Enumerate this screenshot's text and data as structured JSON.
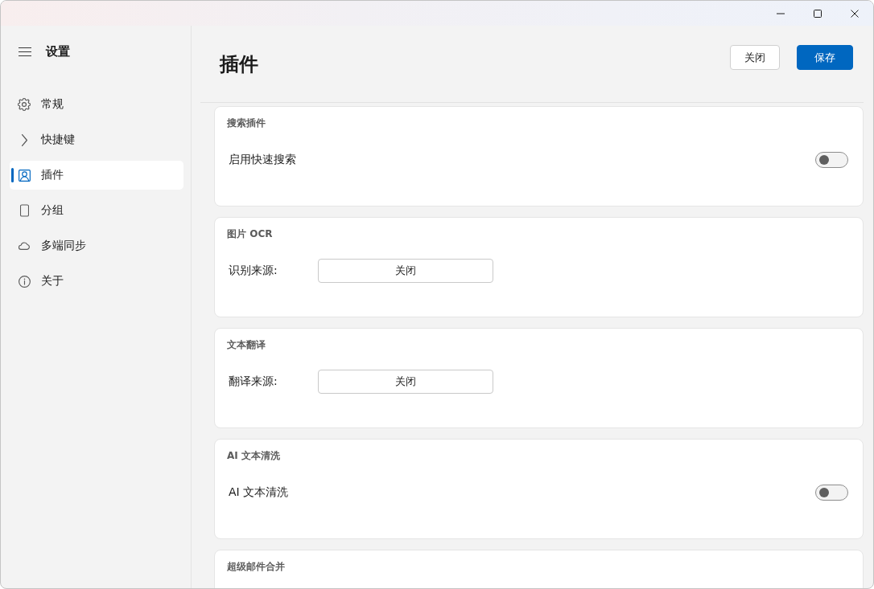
{
  "sidebar": {
    "title": "设置",
    "items": [
      {
        "label": "常规",
        "selected": false
      },
      {
        "label": "快捷键",
        "selected": false
      },
      {
        "label": "插件",
        "selected": true
      },
      {
        "label": "分组",
        "selected": false
      },
      {
        "label": "多端同步",
        "selected": false
      },
      {
        "label": "关于",
        "selected": false
      }
    ]
  },
  "page": {
    "title": "插件",
    "buttons": [
      {
        "label": "关闭",
        "kind": "secondary"
      },
      {
        "label": "保存",
        "kind": "primary"
      }
    ]
  },
  "sections": [
    {
      "heading": "搜索插件",
      "rows": [
        {
          "kind": "toggle",
          "label": "启用快速搜索",
          "on": false
        }
      ]
    },
    {
      "heading": "图片 OCR",
      "rows": [
        {
          "kind": "select",
          "label": "识别来源:",
          "value": "关闭"
        }
      ]
    },
    {
      "heading": "文本翻译",
      "rows": [
        {
          "kind": "select",
          "label": "翻译来源:",
          "value": "关闭"
        }
      ]
    },
    {
      "heading": "AI 文本清洗",
      "rows": [
        {
          "kind": "toggle",
          "label": "AI 文本清洗",
          "on": false
        }
      ]
    },
    {
      "heading": "超级邮件合并"
    }
  ]
}
